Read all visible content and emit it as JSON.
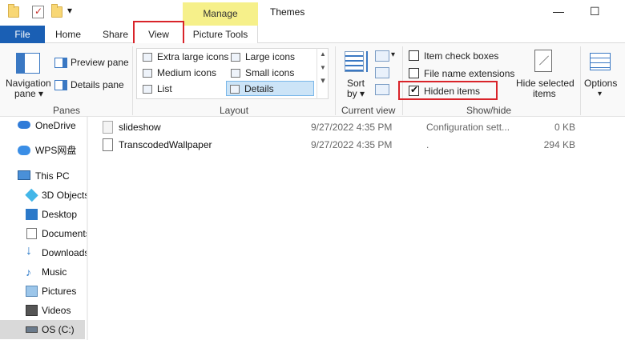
{
  "window": {
    "title": "Themes",
    "context_tab": "Manage",
    "controls": {
      "minimize": "—",
      "maximize": "☐"
    }
  },
  "quick_access": {
    "dropdown": "▾"
  },
  "tabs": [
    {
      "label": "File"
    },
    {
      "label": "Home"
    },
    {
      "label": "Share"
    },
    {
      "label": "View"
    },
    {
      "label": "Picture Tools"
    }
  ],
  "ribbon": {
    "panes": {
      "navigation_pane": "Navigation",
      "navigation_pane_line2": "pane ▾",
      "preview_pane": "Preview pane",
      "details_pane": "Details pane",
      "group_label": "Panes"
    },
    "layout": {
      "items": [
        "Extra large icons",
        "Large icons",
        "Medium icons",
        "Small icons",
        "List",
        "Details"
      ],
      "selected": "Details",
      "group_label": "Layout",
      "scroll_up": "▲",
      "scroll_down": "▼",
      "scroll_more": "▾"
    },
    "current_view": {
      "sort_by": "Sort",
      "sort_by_line2": "by ▾",
      "group_label": "Current view",
      "dropdown": "▾"
    },
    "show_hide": {
      "item_check_boxes": "Item check boxes",
      "file_name_extensions": "File name extensions",
      "hidden_items": "Hidden items",
      "hidden_items_checked": true,
      "hide_selected": "Hide selected",
      "hide_selected_line2": "items",
      "group_label": "Show/hide"
    },
    "options": {
      "label": "Options",
      "dropdown": "▾"
    }
  },
  "nav": {
    "items": [
      "OneDrive",
      "WPS网盘",
      "This PC",
      "3D Objects",
      "Desktop",
      "Documents",
      "Downloads",
      "Music",
      "Pictures",
      "Videos",
      "OS (C:)"
    ],
    "selected": "OS (C:)"
  },
  "files": [
    {
      "name": "slideshow",
      "date": "9/27/2022 4:35 PM",
      "type": "Configuration sett...",
      "size": "0 KB"
    },
    {
      "name": "TranscodedWallpaper",
      "date": "9/27/2022 4:35 PM",
      "type": ".",
      "size": "294 KB"
    }
  ],
  "colors": {
    "file_tab": "#1a5fb4",
    "manage_tab": "#f6f08a",
    "highlight_red": "#d9242a",
    "selected_layout": "#cce4f7",
    "nav_selected": "#d9d9d9"
  },
  "icons": {
    "quick_access": [
      "folder-icon",
      "properties-icon",
      "folder-icon"
    ],
    "nav": [
      "onedrive-cloud-icon",
      "wps-cloud-icon",
      "computer-icon",
      "3d-objects-icon",
      "desktop-icon",
      "documents-icon",
      "downloads-icon",
      "music-icon",
      "pictures-icon",
      "videos-icon",
      "drive-icon"
    ]
  }
}
